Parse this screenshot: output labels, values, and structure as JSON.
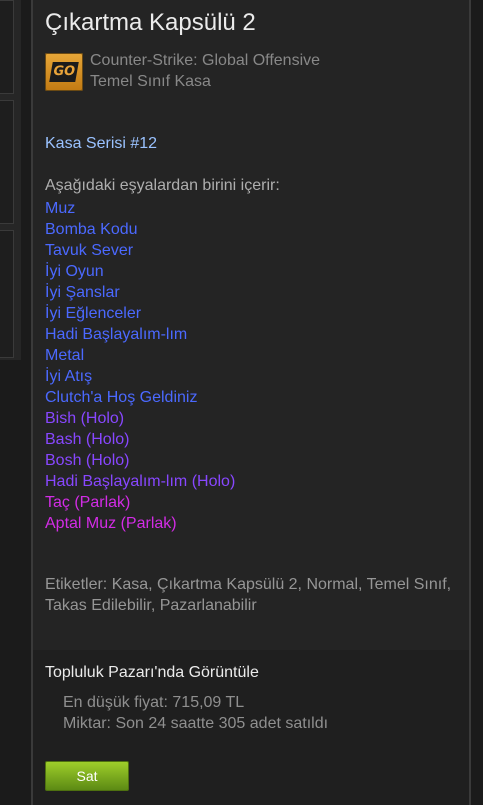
{
  "item": {
    "title": "Çıkartma Kapsülü 2",
    "game_name": "Counter-Strike: Global Offensive",
    "item_type": "Temel Sınıf Kasa",
    "game_icon": "csgo-logo-icon",
    "game_icon_text": "GO"
  },
  "description": {
    "series": "Kasa Serisi #12",
    "contains_label": "Aşağıdaki eşyalardan birini içerir:",
    "items": [
      {
        "label": "Muz",
        "color": "#4b69ff"
      },
      {
        "label": "Bomba Kodu",
        "color": "#4b69ff"
      },
      {
        "label": "Tavuk Sever",
        "color": "#4b69ff"
      },
      {
        "label": "İyi Oyun",
        "color": "#4b69ff"
      },
      {
        "label": "İyi Şanslar",
        "color": "#4b69ff"
      },
      {
        "label": "İyi Eğlenceler",
        "color": "#4b69ff"
      },
      {
        "label": "Hadi Başlayalım-lım",
        "color": "#4b69ff"
      },
      {
        "label": "Metal",
        "color": "#4b69ff"
      },
      {
        "label": "İyi Atış",
        "color": "#4b69ff"
      },
      {
        "label": "Clutch'a Hoş Geldiniz",
        "color": "#4b69ff"
      },
      {
        "label": "Bish (Holo)",
        "color": "#8847ff"
      },
      {
        "label": "Bash (Holo)",
        "color": "#8847ff"
      },
      {
        "label": "Bosh (Holo)",
        "color": "#8847ff"
      },
      {
        "label": "Hadi Başlayalım-lım (Holo)",
        "color": "#8847ff"
      },
      {
        "label": "Taç (Parlak)",
        "color": "#d32ce6"
      },
      {
        "label": "Aptal Muz (Parlak)",
        "color": "#d32ce6"
      }
    ]
  },
  "tags": {
    "text": "Etiketler: Kasa, Çıkartma Kapsülü 2, Normal, Temel Sınıf, Takas Edilebilir, Pazarlanabilir"
  },
  "market": {
    "title": "Topluluk Pazarı'nda Görüntüle",
    "lowest_price": "En düşük fiyat: 715,09 TL",
    "volume": "Miktar: Son 24 saatte 305 adet satıldı",
    "sell_label": "Sat"
  },
  "colors": {
    "background": "#1b1b1b",
    "panel": "#242424",
    "series_text": "#9ac2ff",
    "mil_spec": "#4b69ff",
    "restricted": "#8847ff",
    "classified": "#d32ce6",
    "sell_button": "#75b022"
  }
}
